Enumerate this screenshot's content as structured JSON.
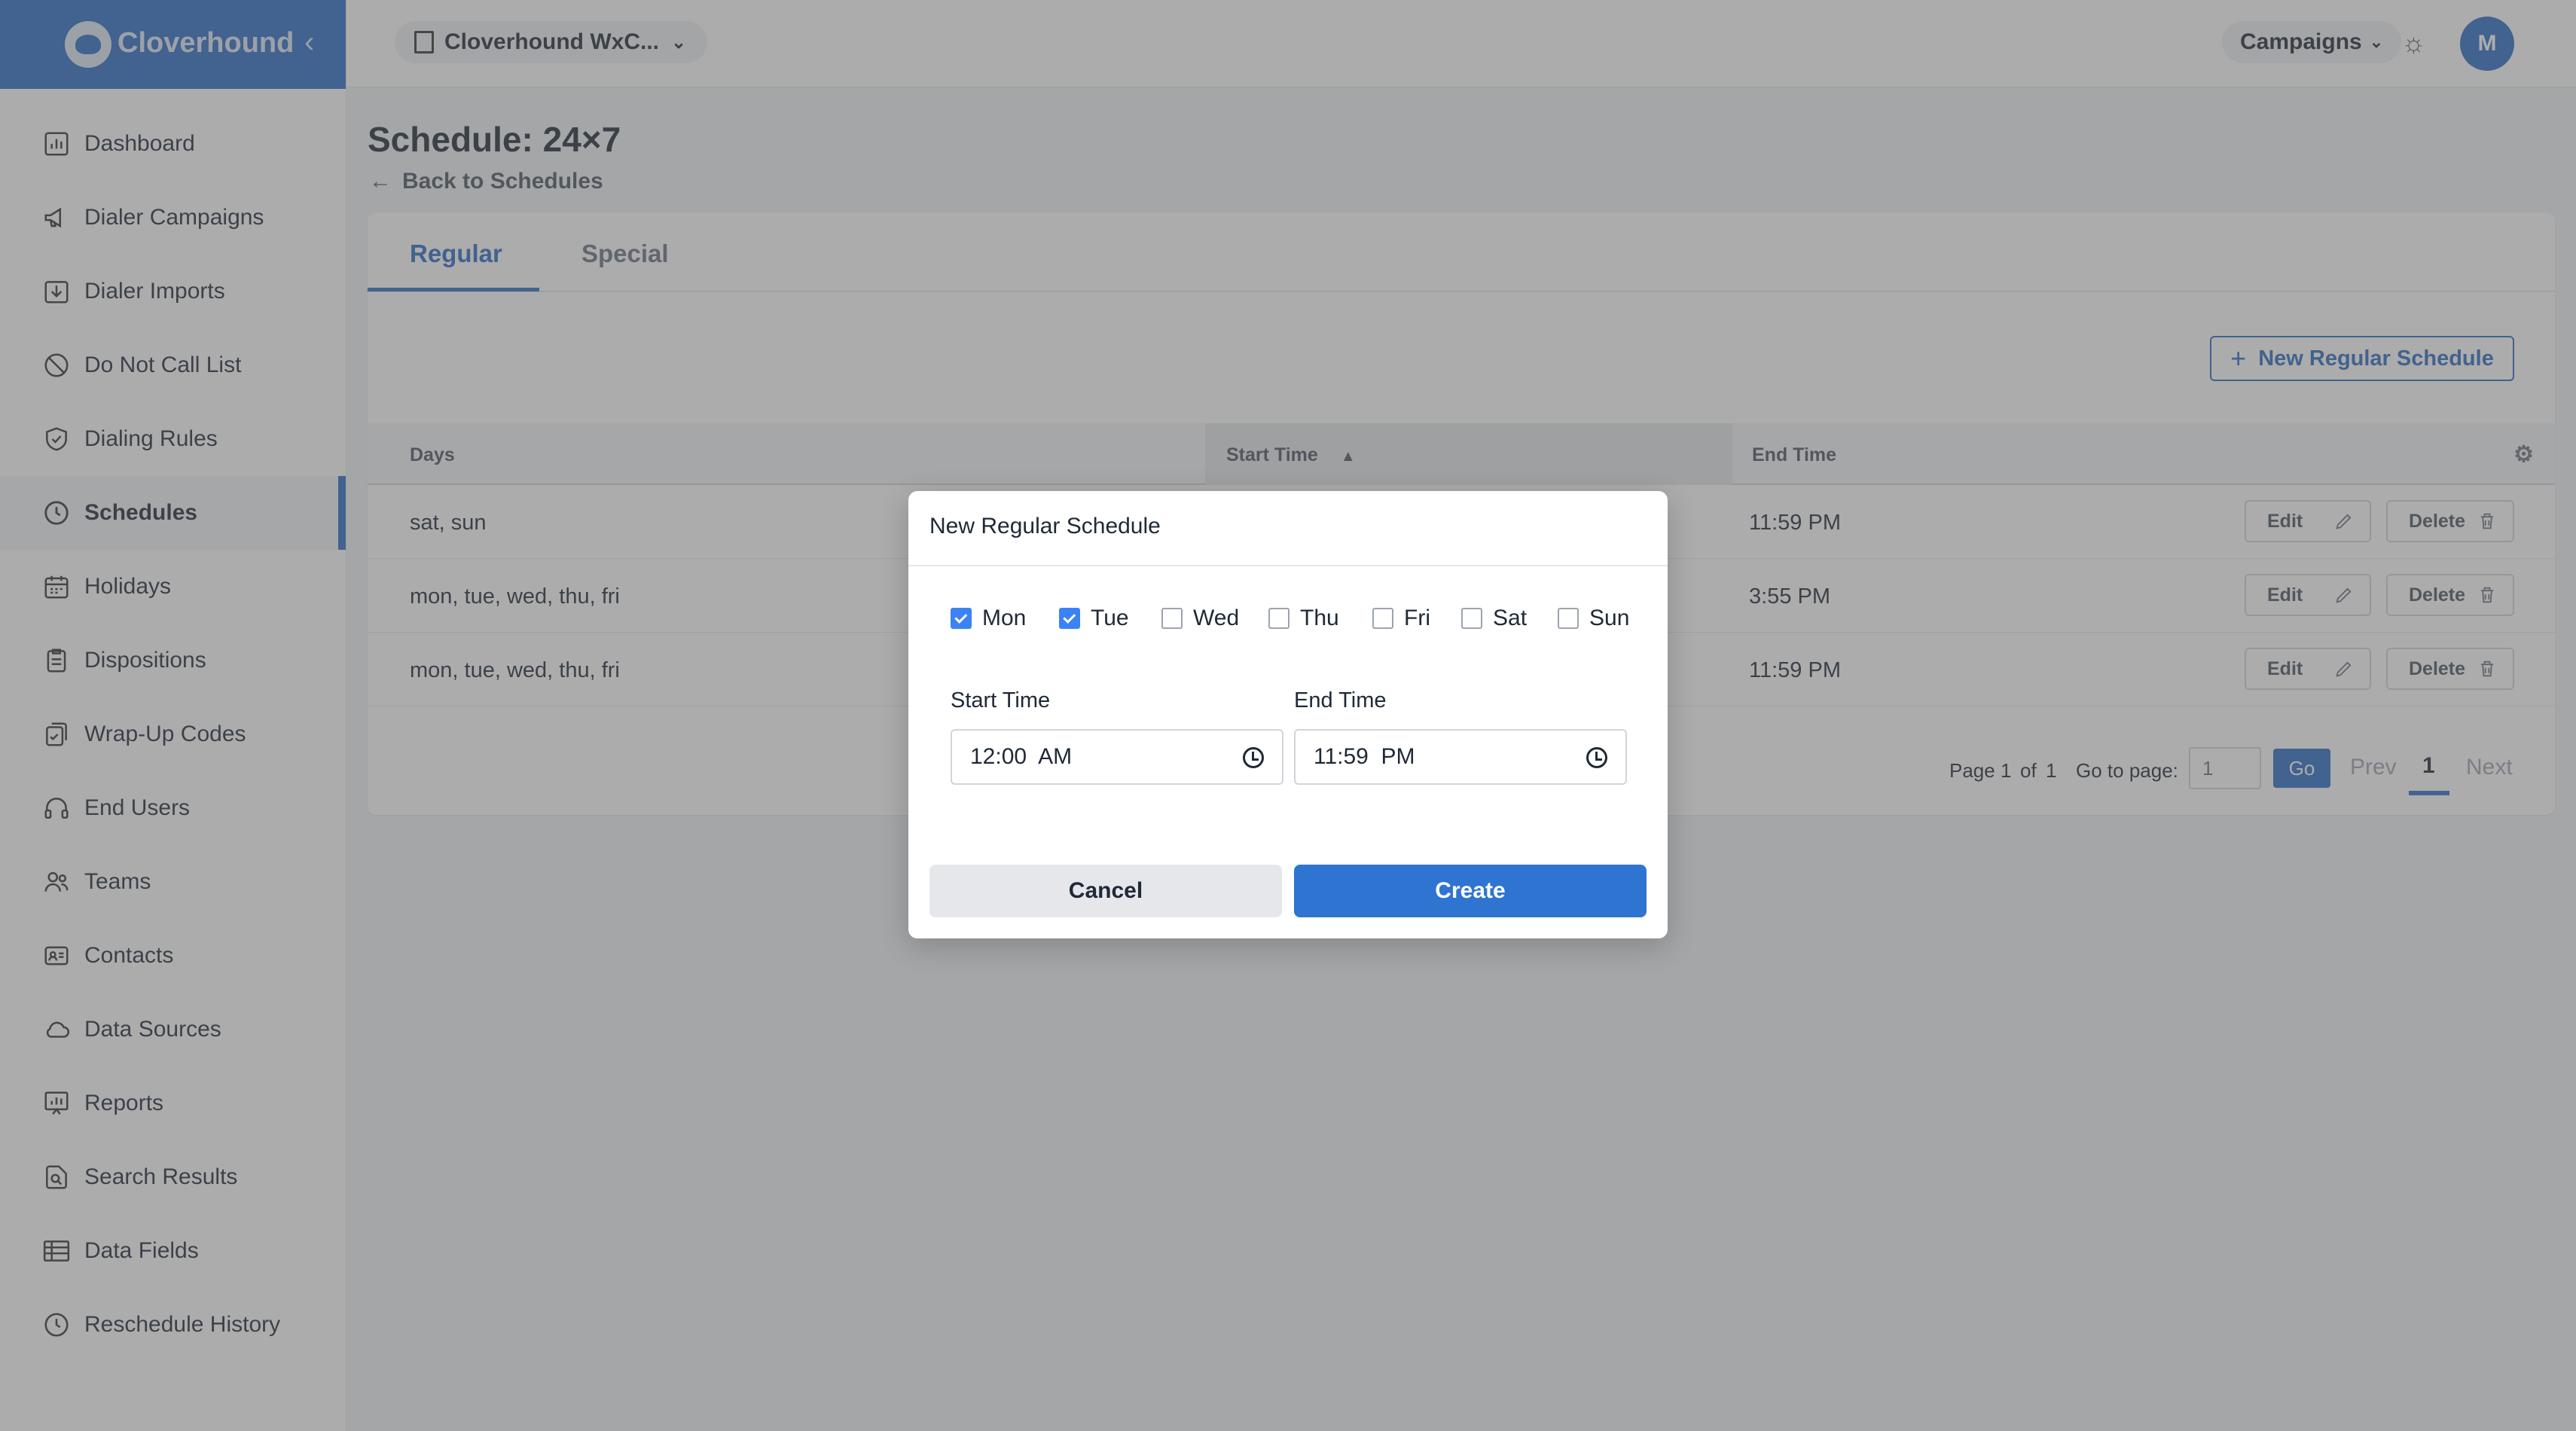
{
  "brand": {
    "name": "Cloverhound"
  },
  "sidebar": {
    "items": [
      {
        "label": "Dashboard",
        "icon": "chart-icon"
      },
      {
        "label": "Dialer Campaigns",
        "icon": "megaphone-icon"
      },
      {
        "label": "Dialer Imports",
        "icon": "import-icon"
      },
      {
        "label": "Do Not Call List",
        "icon": "block-icon"
      },
      {
        "label": "Dialing Rules",
        "icon": "shield-icon"
      },
      {
        "label": "Schedules",
        "icon": "clock-icon",
        "active": true
      },
      {
        "label": "Holidays",
        "icon": "calendar-icon"
      },
      {
        "label": "Dispositions",
        "icon": "clipboard-icon"
      },
      {
        "label": "Wrap-Up Codes",
        "icon": "tag-icon"
      },
      {
        "label": "End Users",
        "icon": "headset-icon"
      },
      {
        "label": "Teams",
        "icon": "users-icon"
      },
      {
        "label": "Contacts",
        "icon": "contact-card-icon"
      },
      {
        "label": "Data Sources",
        "icon": "cloud-icon"
      },
      {
        "label": "Reports",
        "icon": "report-icon"
      },
      {
        "label": "Search Results",
        "icon": "search-doc-icon"
      },
      {
        "label": "Data Fields",
        "icon": "table-icon"
      },
      {
        "label": "Reschedule History",
        "icon": "history-icon"
      }
    ]
  },
  "topbar": {
    "org": "Cloverhound WxC...",
    "campaigns": "Campaigns",
    "avatar": "M"
  },
  "page": {
    "title": "Schedule: 24×7",
    "back": "Back to Schedules",
    "tabs": [
      "Regular",
      "Special"
    ],
    "new_button": "New Regular Schedule"
  },
  "table": {
    "headers": {
      "days": "Days",
      "start": "Start Time",
      "end": "End Time"
    },
    "rows": [
      {
        "days": "sat, sun",
        "end": "11:59 PM"
      },
      {
        "days": "mon, tue, wed, thu, fri",
        "end": "3:55 PM"
      },
      {
        "days": "mon, tue, wed, thu, fri",
        "end": "11:59 PM"
      }
    ],
    "edit_label": "Edit",
    "delete_label": "Delete"
  },
  "pager": {
    "page_of_label": "Page 1",
    "of": "of",
    "total": "1",
    "goto_label": "Go to page:",
    "goto_value": "1",
    "go": "Go",
    "prev": "Prev",
    "current": "1",
    "next": "Next"
  },
  "modal": {
    "title": "New Regular Schedule",
    "days": [
      {
        "label": "Mon",
        "checked": true
      },
      {
        "label": "Tue",
        "checked": true
      },
      {
        "label": "Wed",
        "checked": false
      },
      {
        "label": "Thu",
        "checked": false
      },
      {
        "label": "Fri",
        "checked": false
      },
      {
        "label": "Sat",
        "checked": false
      },
      {
        "label": "Sun",
        "checked": false
      }
    ],
    "start_label": "Start Time",
    "start_value": "12:00  AM",
    "end_label": "End Time",
    "end_value": "11:59  PM",
    "cancel": "Cancel",
    "create": "Create"
  },
  "colors": {
    "accent": "#2a6ac4",
    "primary_button": "#2f74d0",
    "checkbox": "#3b82f6"
  }
}
